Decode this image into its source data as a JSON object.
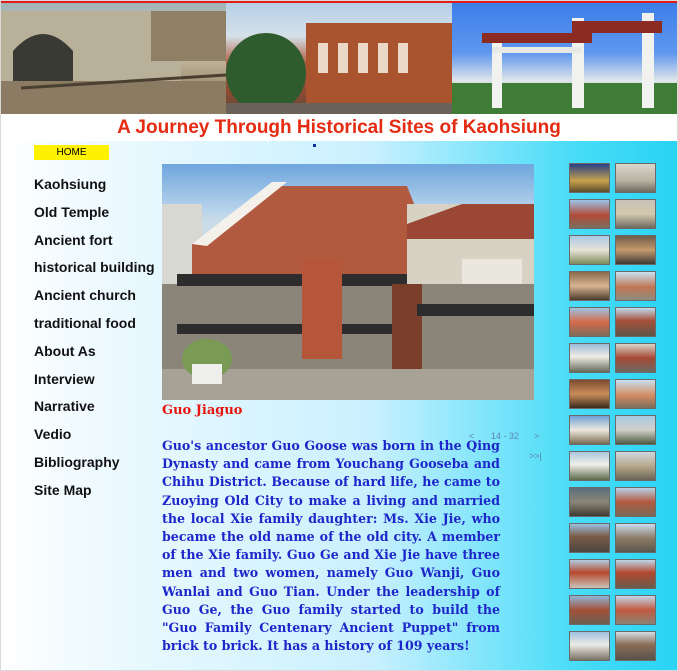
{
  "banner": {
    "title": "A Journey Through Historical Sites of  Kaohsiung"
  },
  "nav": {
    "home_label": "HOME",
    "items": [
      "Kaohsiung",
      "Old Temple",
      "Ancient fort",
      "historical building",
      "Ancient church",
      "traditional food",
      "About As",
      "Interview",
      "Narrative",
      "Vedio",
      "Bibliography",
      "Site Map"
    ]
  },
  "main": {
    "caption": "Guo Jiaguo",
    "pager": {
      "prev": "<",
      "counter": "14 - 32",
      "next": ">",
      "last": ">>|"
    },
    "body": "Guo's ancestor Guo Goose was born in the Qing Dynasty and came from Youchang Gooseba and Chihu District. Because of hard life, he came to Zuoying Old City to make a living and married the local Xie family daughter: Ms. Xie Jie, who became the old name of the old city. A member of the Xie family. Guo Ge and Xie Jie have three men and two women, namely Guo Wanji, Guo Wanlai and Guo Tian. Under the leadership of Guo Ge, the Guo family started to build the \"Guo Family Centenary Ancient Puppet\" from brick to brick. It has a history of 109 years!"
  },
  "colors": {
    "title_red": "#e52b12",
    "caption_red": "#e5160e",
    "body_blue": "#1d27c9",
    "home_yellow": "#fff200",
    "gradient_cyan": "#2ad3f4"
  }
}
